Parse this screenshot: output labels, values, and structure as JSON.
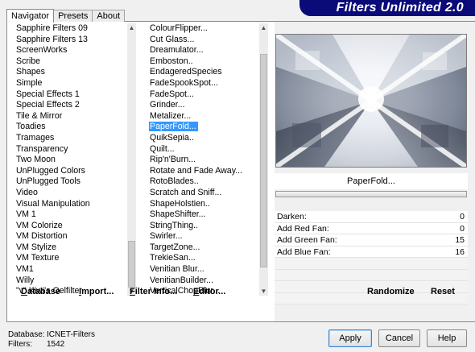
{
  "window": {
    "title": "Filters Unlimited 2.0"
  },
  "tabs": [
    {
      "label": "Navigator",
      "active": true
    },
    {
      "label": "Presets",
      "active": false
    },
    {
      "label": "About",
      "active": false
    }
  ],
  "categories": [
    "Sapphire Filters 09",
    "Sapphire Filters 13",
    "ScreenWorks",
    "Scribe",
    "Shapes",
    "Simple",
    "Special Effects 1",
    "Special Effects 2",
    "Tile & Mirror",
    "Toadies",
    "Tramages",
    "Transparency",
    "Two Moon",
    "UnPlugged Colors",
    "UnPlugged Tools",
    "Video",
    "Visual Manipulation",
    "VM 1",
    "VM Colorize",
    "VM Distortion",
    "VM Stylize",
    "VM Texture",
    "VM1",
    "Willy",
    "\"v\" Kiwi's Oelfilter"
  ],
  "filters": [
    "ColourFlipper...",
    "Cut Glass...",
    "Dreamulator...",
    "Emboston..",
    "EndageredSpecies",
    "FadeSpookSpot...",
    "FadeSpot...",
    "Grinder...",
    "Metalizer...",
    "PaperFold...",
    "QuikSepia..",
    "Quilt...",
    "Rip'n'Burn...",
    "Rotate and Fade Away...",
    "RotoBlades..",
    "Scratch and Sniff...",
    "ShapeHolstien..",
    "ShapeShifter...",
    "StringThing..",
    "Swirler...",
    "TargetZone...",
    "TrekieSan...",
    "Venitian Blur...",
    "VenitianBuilder...",
    "VerticalChopBlur..."
  ],
  "selected_filter": "PaperFold...",
  "params": [
    {
      "label": "Darken:",
      "value": "0"
    },
    {
      "label": "Add Red Fan:",
      "value": "0"
    },
    {
      "label": "Add Green Fan:",
      "value": "15"
    },
    {
      "label": "Add Blue Fan:",
      "value": "16"
    }
  ],
  "buttons": {
    "database": "Database",
    "import": "Import...",
    "filter_info": "Filter Info...",
    "editor": "Editor...",
    "randomize": "Randomize",
    "reset": "Reset",
    "apply": "Apply",
    "cancel": "Cancel",
    "help": "Help"
  },
  "footer": {
    "database_label": "Database:",
    "database_value": "ICNET-Filters",
    "filters_label": "Filters:",
    "filters_value": "1542"
  }
}
